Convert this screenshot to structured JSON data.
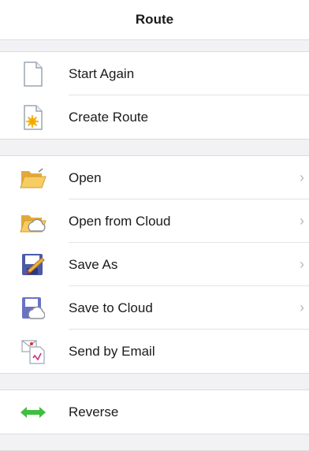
{
  "header": {
    "title": "Route"
  },
  "groups": [
    {
      "items": [
        {
          "label": "Start Again",
          "icon": "blank-document-icon"
        },
        {
          "label": "Create Route",
          "icon": "new-document-icon"
        }
      ]
    },
    {
      "items": [
        {
          "label": "Open",
          "icon": "folder-open-icon",
          "chevron": "›"
        },
        {
          "label": "Open from Cloud",
          "icon": "cloud-folder-icon",
          "chevron": "›"
        },
        {
          "label": "Save As",
          "icon": "save-as-icon",
          "chevron": "›"
        },
        {
          "label": "Save to Cloud",
          "icon": "save-to-cloud-icon",
          "chevron": "›"
        },
        {
          "label": "Send by Email",
          "icon": "email-document-icon"
        }
      ]
    },
    {
      "items": [
        {
          "label": "Reverse",
          "icon": "reverse-arrows-icon"
        }
      ]
    }
  ],
  "colors": {
    "accent_green": "#3fbf3f",
    "folder_yellow": "#f3c24a",
    "separator": "#e3e3e6"
  }
}
